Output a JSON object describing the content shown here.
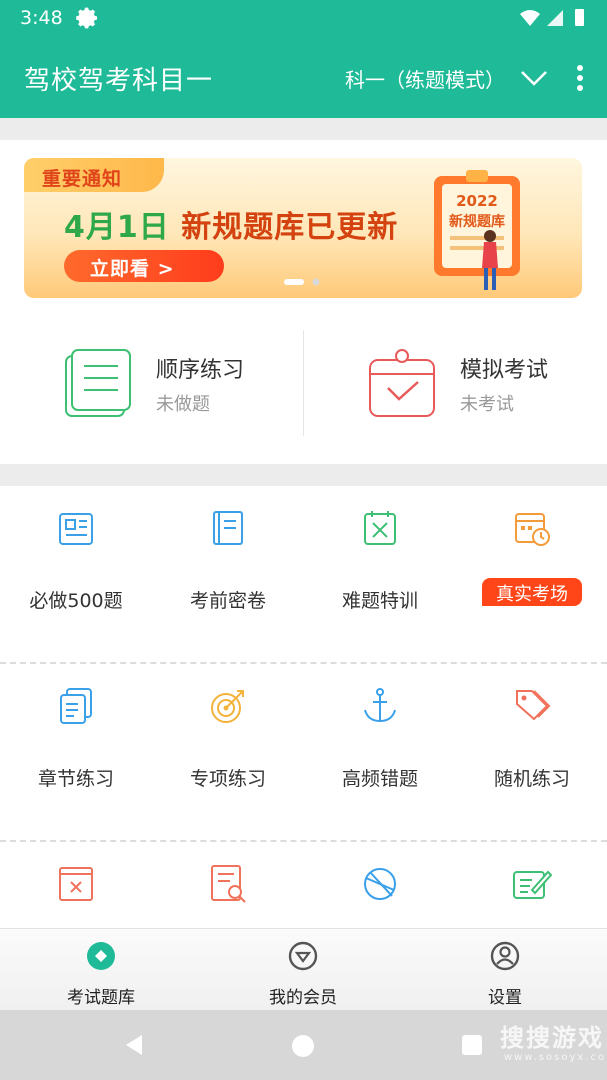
{
  "status_bar": {
    "time": "3:48"
  },
  "app_bar": {
    "title": "驾校驾考科目一",
    "mode": "科一（练题模式）"
  },
  "banner": {
    "tag": "重要通知",
    "headline_date": "4月1日",
    "headline_text": "新规题库已更新",
    "button_label": "立即看 >",
    "art_year": "2022",
    "art_title": "新规题库"
  },
  "practice": [
    {
      "title": "顺序练习",
      "subtitle": "未做题"
    },
    {
      "title": "模拟考试",
      "subtitle": "未考试"
    }
  ],
  "grid": {
    "row1": [
      "必做500题",
      "考前密卷",
      "难题特训",
      ""
    ],
    "badge": "真实考场",
    "row2": [
      "章节练习",
      "专项练习",
      "高频错题",
      "随机练习"
    ]
  },
  "bottom_nav": [
    "考试题库",
    "我的会员",
    "设置"
  ],
  "watermark": {
    "text": "搜搜游戏",
    "sub": "www.sosoyx.com"
  },
  "colors": {
    "primary": "#1fbb98",
    "green_icon": "#3dbf74",
    "red_icon": "#e85a5a",
    "blue_icon": "#3aa0e8",
    "orange_icon": "#f39a3a",
    "badge": "#ff4618"
  }
}
